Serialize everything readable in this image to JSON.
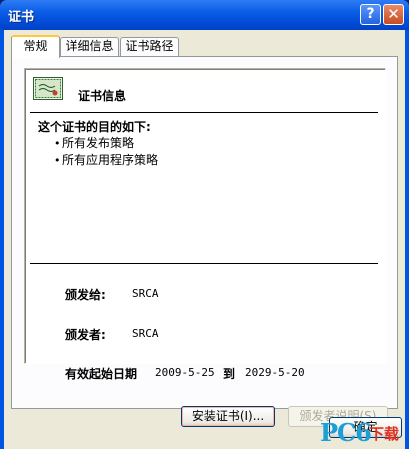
{
  "window": {
    "title": "证书"
  },
  "titlebar": {
    "help_glyph": "?",
    "close_glyph": "✕"
  },
  "tabs": [
    {
      "label": "常规",
      "active": true
    },
    {
      "label": "详细信息",
      "active": false
    },
    {
      "label": "证书路径",
      "active": false
    }
  ],
  "general": {
    "heading": "证书信息",
    "purpose_heading": "这个证书的目的如下:",
    "purposes": [
      "所有发布策略",
      "所有应用程序策略"
    ],
    "bullet": "•",
    "issued_to_label": "颁发给:",
    "issued_to": "SRCA",
    "issued_by_label": "颁发者:",
    "issued_by": "SRCA",
    "validity_label": "有效起始日期",
    "valid_from": "2009-5-25",
    "to_word": "到",
    "valid_to": "2029-5-20"
  },
  "buttons": {
    "install": "安装证书(I)...",
    "issuer_statement": "颁发者说明(S)",
    "ok": "确定"
  },
  "watermark": {
    "brand": "PC6",
    "sub": "下载"
  },
  "colors": {
    "titlebar": "#0054e3",
    "dialog_bg": "#ece9d8",
    "tab_active_accent": "#ffc83c",
    "disabled_text": "#aca899"
  },
  "icons": [
    "certificate-icon",
    "help-icon",
    "close-icon"
  ]
}
